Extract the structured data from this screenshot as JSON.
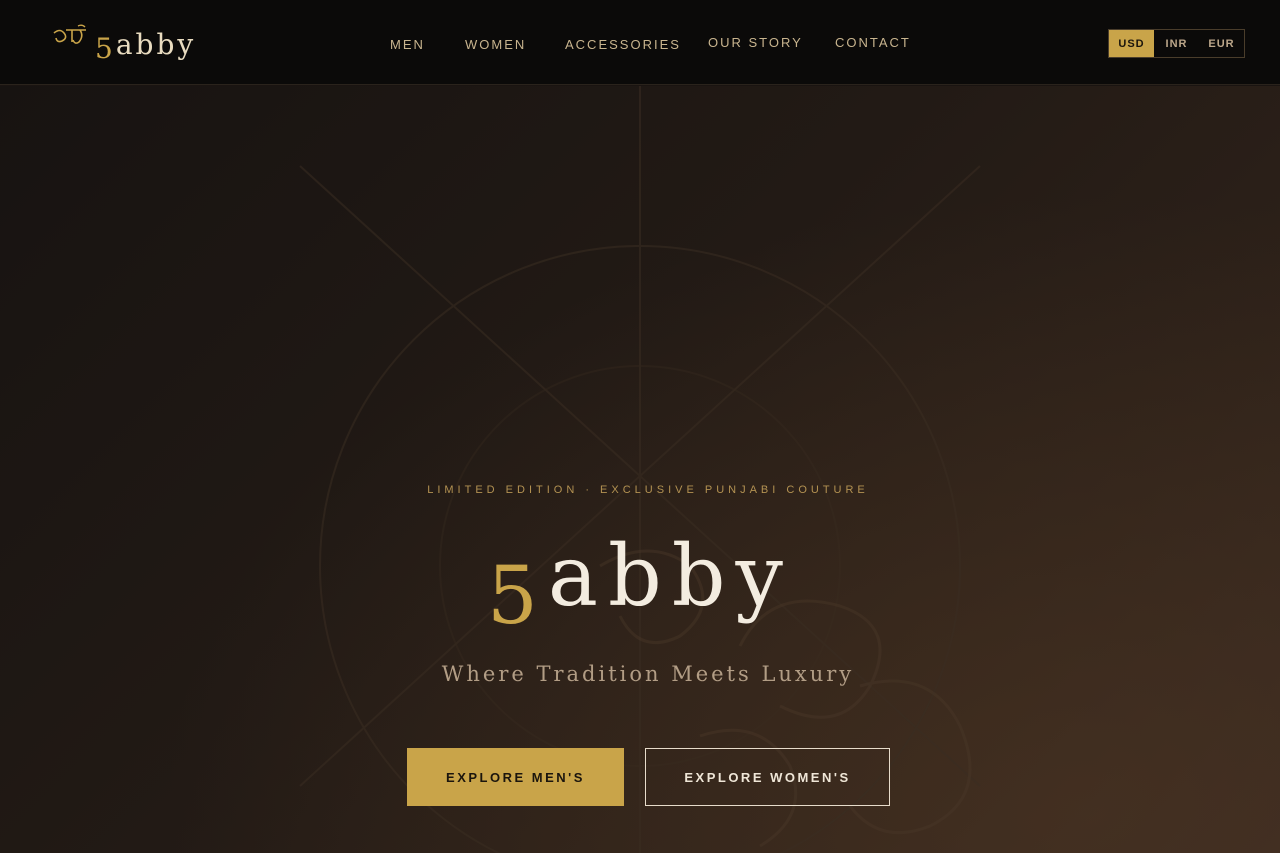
{
  "header": {
    "logo": {
      "icon": "khanda-emblem-icon",
      "prefix": "5",
      "text": "abby"
    },
    "nav": [
      {
        "label": "MEN"
      },
      {
        "label": "WOMEN"
      },
      {
        "label": "ACCESSORIES"
      },
      {
        "label": "OUR STORY"
      },
      {
        "label": "CONTACT"
      }
    ],
    "currency": {
      "options": [
        "USD",
        "INR",
        "EUR"
      ],
      "selected": "USD"
    }
  },
  "hero": {
    "tagline": "LIMITED EDITION · EXCLUSIVE PUNJABI COUTURE",
    "brand_prefix": "5",
    "brand_text": "abby",
    "subtitle": "Where Tradition Meets Luxury",
    "primary_button": "EXPLORE MEN'S",
    "secondary_button": "EXPLORE WOMEN'S"
  },
  "colors": {
    "gold": "#c9a449",
    "header_bg": "#0b0a09",
    "hero_dark": "#171311",
    "hero_warm": "#372820",
    "cream": "#f3ece0"
  }
}
